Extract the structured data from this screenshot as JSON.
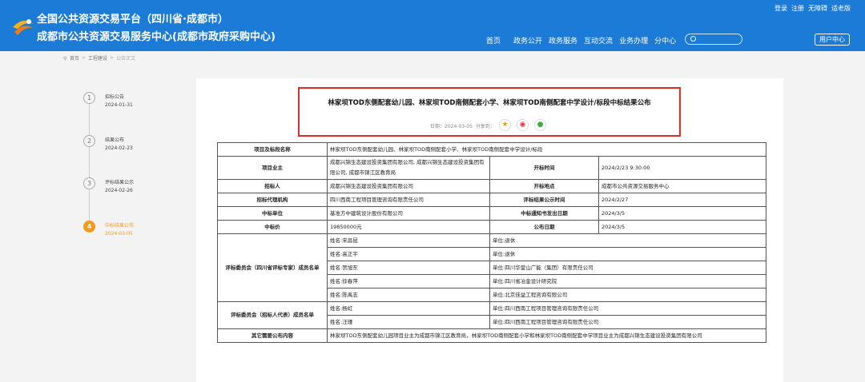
{
  "header": {
    "title_line1": "全国公共资源交易平台（四川省·成都市）",
    "title_line2": "成都市公共资源交易服务中心(成都市政府采购中心)",
    "top_links": [
      "登录",
      "注册",
      "无障碍",
      "适老版"
    ],
    "nav": [
      "首页",
      "政务公开",
      "政务服务",
      "互动交流",
      "业务办理",
      "分中心"
    ],
    "user_center": "用户中心"
  },
  "breadcrumb": {
    "home": "首页",
    "sep": ">",
    "level2": "工程建设",
    "current": "公告正文"
  },
  "timeline": [
    {
      "num": "1",
      "label": "招标公告",
      "date": "2024-01-31"
    },
    {
      "num": "2",
      "label": "结果公布",
      "date": "2024-02-23"
    },
    {
      "num": "3",
      "label": "评标结果公示",
      "date": "2024-02-26"
    },
    {
      "num": "4",
      "label": "中标结果公布",
      "date": "2024-03-05"
    }
  ],
  "article": {
    "title": "林家坝TOD东侧配套幼儿园、林家坝TOD南侧配套小学、林家坝TOD南侧配套中学设计/标段中标结果公布",
    "date_label": "日期：",
    "date": "2024-03-05",
    "share_label": "分享到："
  },
  "table": {
    "project_name_label": "项目及标段名称",
    "project_name": "林家坝TOD东侧配套幼儿园、林家坝TOD南侧配套小学、林家坝TOD南侧配套中学设计/标段",
    "owner_label": "项目业主",
    "owner": "成都兴锦生态建设投资集团有限公司, 成都兴锦生态建设投资集团有限公司, 成都市锦江区教育局",
    "open_time_label": "开标时间",
    "open_time": "2024/2/23 9:30:00",
    "tenderer_label": "招标人",
    "tenderer": "成都兴锦生态建设投资集团有限公司",
    "open_place_label": "开标地点",
    "open_place": "成都市公共资源交易服务中心",
    "agency_label": "招标代理机构",
    "agency": "四川西南工程项目管理咨询有限责任公司",
    "publicity_label": "评标结果公示时间",
    "publicity": "2024/2/27",
    "winner_label": "中标单位",
    "winner": "基准方中建筑设计股份有限公司",
    "notice_date_label": "中标通知书发出日期",
    "notice_date": "2024/3/5",
    "price_label": "中标价",
    "price": "19850000元",
    "announce_date_label": "公布日期",
    "announce_date": "2024/3/5",
    "committee_experts_label": "评标委员会（四川省评标专家）成员名单",
    "experts": [
      {
        "name": "姓名:宋昌昆",
        "unit": "单位:退休"
      },
      {
        "name": "姓名:高正平",
        "unit": "单位:退休"
      },
      {
        "name": "姓名:贺旭东",
        "unit": "单位:四川华蓥山广能（集团）有限责任公司"
      },
      {
        "name": "姓名:徐春萍",
        "unit": "单位:四川省冶金设计研究院"
      },
      {
        "name": "姓名:陈禹志",
        "unit": "单位:北京佳益工程咨询有限公司"
      }
    ],
    "committee_tenderer_label": "评标委员会（招标人代表）成员名单",
    "tenderer_reps": [
      {
        "name": "姓名:杨虹",
        "unit": "单位:四川西南工程项目管理咨询有限责任公司"
      },
      {
        "name": "姓名:汪瑾",
        "unit": "单位:四川西南工程项目管理咨询有限责任公司"
      }
    ],
    "other_label": "其它需要公布内容",
    "other": "林家坝TOD东侧配套幼儿园项目业主为成都市锦江区教育局，林家坝TOD南侧配套小学和林家坝TOD南侧配套中学项目业主为成都兴锦生态建设投资集团有限公司"
  },
  "colors": {
    "header_bg": "#1c7bd6",
    "accent_orange": "#f39a1f",
    "highlight_red": "#e02b2b"
  }
}
